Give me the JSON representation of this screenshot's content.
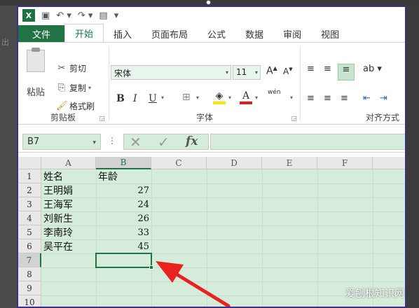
{
  "ghost_text": "出",
  "qat": {
    "icon": "X"
  },
  "tabs": {
    "file": "文件",
    "items": [
      "开始",
      "插入",
      "页面布局",
      "公式",
      "数据",
      "审阅",
      "视图"
    ]
  },
  "clipboard": {
    "paste": "粘贴",
    "cut": "剪切",
    "copy": "复制",
    "format_painter": "格式刷",
    "label": "剪贴板"
  },
  "font": {
    "name": "宋体",
    "size": "11",
    "bold": "B",
    "italic": "I",
    "underline": "U",
    "label": "字体",
    "wen": "wén"
  },
  "alignment": {
    "label": "对齐方式"
  },
  "namebox": "B7",
  "columns": [
    "A",
    "B",
    "C",
    "D",
    "E",
    "F"
  ],
  "rows": [
    "1",
    "2",
    "3",
    "4",
    "5",
    "6",
    "7",
    "8",
    "9",
    "10"
  ],
  "table": {
    "headers": [
      "姓名",
      "年龄"
    ],
    "data": [
      [
        "王明娟",
        "27"
      ],
      [
        "王海军",
        "24"
      ],
      [
        "刘新生",
        "26"
      ],
      [
        "李南玲",
        "33"
      ],
      [
        "吴平在",
        "45"
      ]
    ]
  },
  "colors": {
    "excel_green": "#217346",
    "selection_bg": "#d4ecd9",
    "arrow": "#e8221f"
  },
  "watermark": "爱刨根知识网"
}
